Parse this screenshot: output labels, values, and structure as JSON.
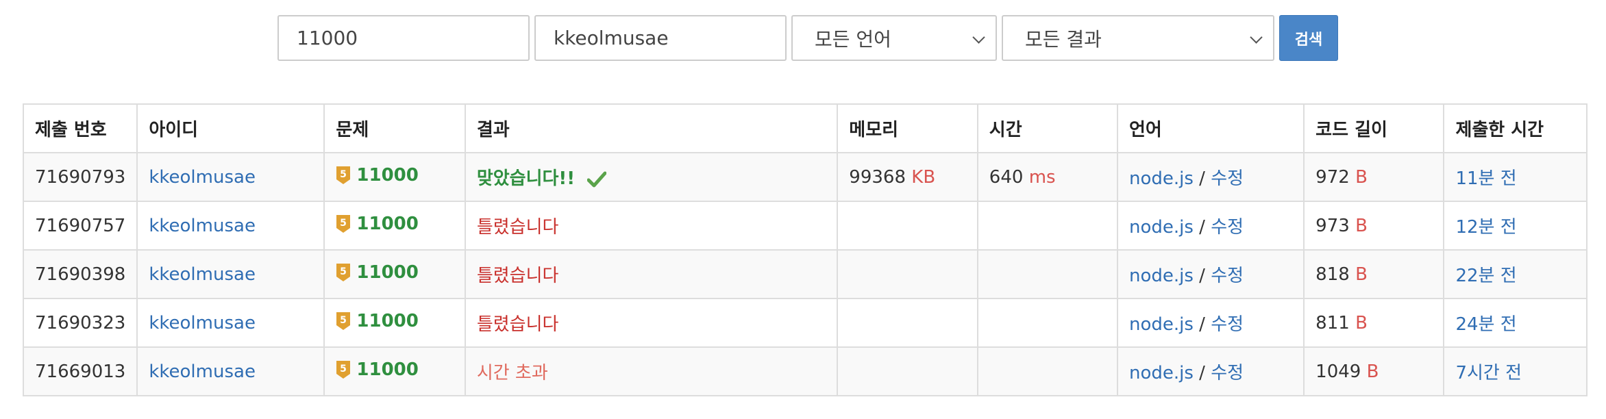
{
  "search": {
    "problem_value": "11000",
    "user_value": "kkeolmusae",
    "language_selected": "모든 언어",
    "result_selected": "모든 결과",
    "search_label": "검색"
  },
  "table": {
    "headers": {
      "submission_id": "제출 번호",
      "user_id": "아이디",
      "problem": "문제",
      "result": "결과",
      "memory": "메모리",
      "time": "시간",
      "language": "언어",
      "code_length": "코드 길이",
      "submitted_at": "제출한 시간"
    },
    "rows": [
      {
        "submission_id": "71690793",
        "user_id": "kkeolmusae",
        "tier": "5",
        "problem": "11000",
        "result": "맞았습니다!!",
        "result_type": "ac",
        "memory": "99368",
        "memory_unit": "KB",
        "time": "640",
        "time_unit": "ms",
        "language": "node.js",
        "separator": "/",
        "edit": "수정",
        "code_length": "972",
        "code_unit": "B",
        "submitted_at": "11분 전"
      },
      {
        "submission_id": "71690757",
        "user_id": "kkeolmusae",
        "tier": "5",
        "problem": "11000",
        "result": "틀렸습니다",
        "result_type": "wa",
        "memory": "",
        "memory_unit": "",
        "time": "",
        "time_unit": "",
        "language": "node.js",
        "separator": "/",
        "edit": "수정",
        "code_length": "973",
        "code_unit": "B",
        "submitted_at": "12분 전"
      },
      {
        "submission_id": "71690398",
        "user_id": "kkeolmusae",
        "tier": "5",
        "problem": "11000",
        "result": "틀렸습니다",
        "result_type": "wa",
        "memory": "",
        "memory_unit": "",
        "time": "",
        "time_unit": "",
        "language": "node.js",
        "separator": "/",
        "edit": "수정",
        "code_length": "818",
        "code_unit": "B",
        "submitted_at": "22분 전"
      },
      {
        "submission_id": "71690323",
        "user_id": "kkeolmusae",
        "tier": "5",
        "problem": "11000",
        "result": "틀렸습니다",
        "result_type": "wa",
        "memory": "",
        "memory_unit": "",
        "time": "",
        "time_unit": "",
        "language": "node.js",
        "separator": "/",
        "edit": "수정",
        "code_length": "811",
        "code_unit": "B",
        "submitted_at": "24분 전"
      },
      {
        "submission_id": "71669013",
        "user_id": "kkeolmusae",
        "tier": "5",
        "problem": "11000",
        "result": "시간 초과",
        "result_type": "tle",
        "memory": "",
        "memory_unit": "",
        "time": "",
        "time_unit": "",
        "language": "node.js",
        "separator": "/",
        "edit": "수정",
        "code_length": "1049",
        "code_unit": "B",
        "submitted_at": "7시간 전"
      }
    ]
  },
  "colors": {
    "accepted": "#2f8f3f",
    "wrong": "#c9302c",
    "time_limit": "#e06a5e",
    "link": "#2f6db3",
    "unit": "#d9534f",
    "tier_badge": "#e0a030",
    "search_button": "#4a86c8"
  },
  "icons": {
    "tier": "tier-badge-icon",
    "accepted": "checkmark-icon",
    "dropdown": "chevron-down-icon"
  }
}
